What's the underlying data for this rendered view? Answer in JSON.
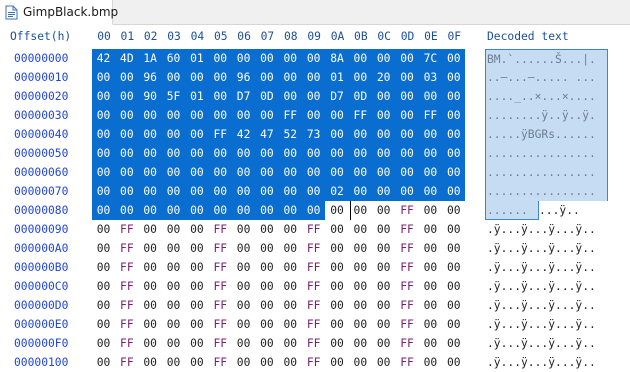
{
  "tab": {
    "title": "GimpBlack.bmp",
    "icon": "file-icon"
  },
  "header": {
    "offset_label": "Offset(h)",
    "columns": [
      "00",
      "01",
      "02",
      "03",
      "04",
      "05",
      "06",
      "07",
      "08",
      "09",
      "0A",
      "0B",
      "0C",
      "0D",
      "0E",
      "0F"
    ],
    "decoded_label": "Decoded text"
  },
  "rows": [
    {
      "offset": "00000000",
      "bytes": [
        "42",
        "4D",
        "1A",
        "60",
        "01",
        "00",
        "00",
        "00",
        "00",
        "00",
        "8A",
        "00",
        "00",
        "00",
        "7C",
        "00"
      ],
      "text": "BM.`......Š...|."
    },
    {
      "offset": "00000010",
      "bytes": [
        "00",
        "00",
        "96",
        "00",
        "00",
        "00",
        "96",
        "00",
        "00",
        "00",
        "01",
        "00",
        "20",
        "00",
        "03",
        "00"
      ],
      "text": "..–...–..... ..."
    },
    {
      "offset": "00000020",
      "bytes": [
        "00",
        "00",
        "90",
        "5F",
        "01",
        "00",
        "D7",
        "0D",
        "00",
        "00",
        "D7",
        "0D",
        "00",
        "00",
        "00",
        "00"
      ],
      "text": "...._..×...×...."
    },
    {
      "offset": "00000030",
      "bytes": [
        "00",
        "00",
        "00",
        "00",
        "00",
        "00",
        "00",
        "00",
        "FF",
        "00",
        "00",
        "FF",
        "00",
        "00",
        "FF",
        "00"
      ],
      "text": "........ÿ..ÿ..ÿ."
    },
    {
      "offset": "00000040",
      "bytes": [
        "00",
        "00",
        "00",
        "00",
        "00",
        "FF",
        "42",
        "47",
        "52",
        "73",
        "00",
        "00",
        "00",
        "00",
        "00",
        "00"
      ],
      "text": ".....ÿBGRs......"
    },
    {
      "offset": "00000050",
      "bytes": [
        "00",
        "00",
        "00",
        "00",
        "00",
        "00",
        "00",
        "00",
        "00",
        "00",
        "00",
        "00",
        "00",
        "00",
        "00",
        "00"
      ],
      "text": "................"
    },
    {
      "offset": "00000060",
      "bytes": [
        "00",
        "00",
        "00",
        "00",
        "00",
        "00",
        "00",
        "00",
        "00",
        "00",
        "00",
        "00",
        "00",
        "00",
        "00",
        "00"
      ],
      "text": "................"
    },
    {
      "offset": "00000070",
      "bytes": [
        "00",
        "00",
        "00",
        "00",
        "00",
        "00",
        "00",
        "00",
        "00",
        "00",
        "02",
        "00",
        "00",
        "00",
        "00",
        "00"
      ],
      "text": "................"
    },
    {
      "offset": "00000080",
      "bytes": [
        "00",
        "00",
        "00",
        "00",
        "00",
        "00",
        "00",
        "00",
        "00",
        "00",
        "00",
        "00",
        "00",
        "FF",
        "00",
        "00"
      ],
      "text": ".........ÿ..",
      "text_selected": "......",
      "text_rest": "...ÿ.."
    },
    {
      "offset": "00000090",
      "bytes": [
        "00",
        "FF",
        "00",
        "00",
        "00",
        "FF",
        "00",
        "00",
        "00",
        "FF",
        "00",
        "00",
        "00",
        "FF",
        "00",
        "00"
      ],
      "text": ".ÿ...ÿ...ÿ...ÿ.."
    },
    {
      "offset": "000000A0",
      "bytes": [
        "00",
        "FF",
        "00",
        "00",
        "00",
        "FF",
        "00",
        "00",
        "00",
        "FF",
        "00",
        "00",
        "00",
        "FF",
        "00",
        "00"
      ],
      "text": ".ÿ...ÿ...ÿ...ÿ.."
    },
    {
      "offset": "000000B0",
      "bytes": [
        "00",
        "FF",
        "00",
        "00",
        "00",
        "FF",
        "00",
        "00",
        "00",
        "FF",
        "00",
        "00",
        "00",
        "FF",
        "00",
        "00"
      ],
      "text": ".ÿ...ÿ...ÿ...ÿ.."
    },
    {
      "offset": "000000C0",
      "bytes": [
        "00",
        "FF",
        "00",
        "00",
        "00",
        "FF",
        "00",
        "00",
        "00",
        "FF",
        "00",
        "00",
        "00",
        "FF",
        "00",
        "00"
      ],
      "text": ".ÿ...ÿ...ÿ...ÿ.."
    },
    {
      "offset": "000000D0",
      "bytes": [
        "00",
        "FF",
        "00",
        "00",
        "00",
        "FF",
        "00",
        "00",
        "00",
        "FF",
        "00",
        "00",
        "00",
        "FF",
        "00",
        "00"
      ],
      "text": ".ÿ...ÿ...ÿ...ÿ.."
    },
    {
      "offset": "000000E0",
      "bytes": [
        "00",
        "FF",
        "00",
        "00",
        "00",
        "FF",
        "00",
        "00",
        "00",
        "FF",
        "00",
        "00",
        "00",
        "FF",
        "00",
        "00"
      ],
      "text": ".ÿ...ÿ...ÿ...ÿ.."
    },
    {
      "offset": "000000F0",
      "bytes": [
        "00",
        "FF",
        "00",
        "00",
        "00",
        "FF",
        "00",
        "00",
        "00",
        "FF",
        "00",
        "00",
        "00",
        "FF",
        "00",
        "00"
      ],
      "text": ".ÿ...ÿ...ÿ...ÿ.."
    },
    {
      "offset": "00000100",
      "bytes": [
        "00",
        "FF",
        "00",
        "00",
        "00",
        "FF",
        "00",
        "00",
        "00",
        "FF",
        "00",
        "00",
        "00",
        "FF",
        "00",
        "00"
      ],
      "text": ".ÿ...ÿ...ÿ...ÿ.."
    }
  ],
  "selection": {
    "rows_fully_selected": 8,
    "last_row_selected_bytes": 10,
    "selection_color": "#0a6ed1",
    "text_selection_color": "#c6dcf2"
  },
  "colors": {
    "header": "#1b4f9c",
    "offset": "#2046d8",
    "ff_byte": "#7a1f6e"
  }
}
